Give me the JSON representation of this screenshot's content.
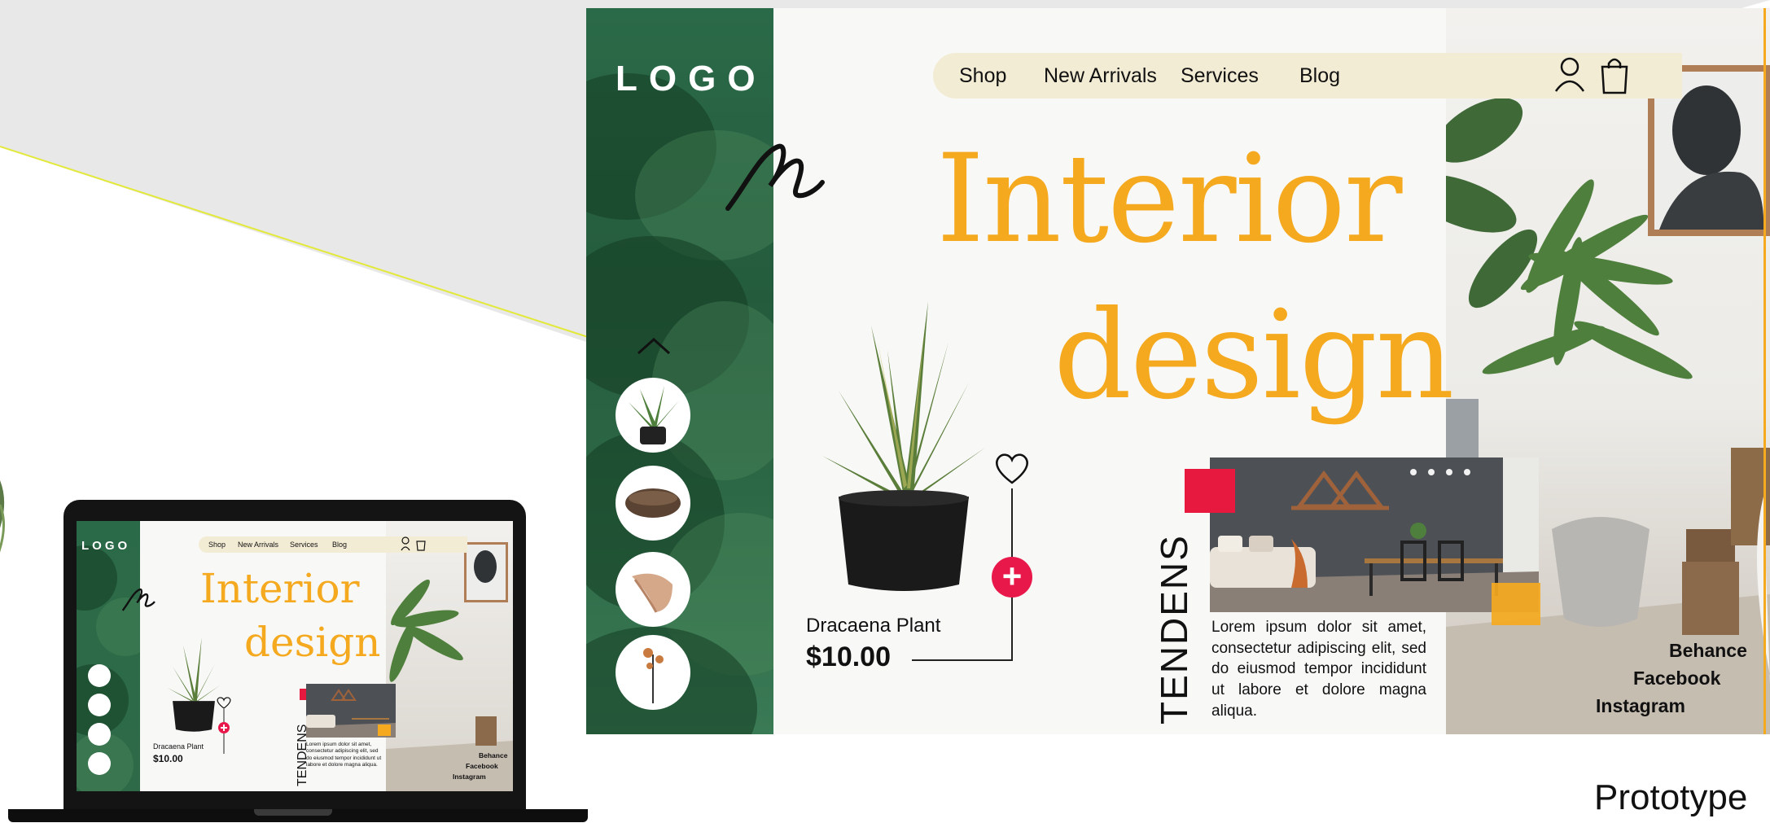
{
  "main": {
    "logo": "LOGO",
    "nav": [
      "Shop",
      "New Arrivals",
      "Services",
      "Blog"
    ],
    "hero_title_line1": "Interior",
    "hero_title_line2": "design",
    "product": {
      "name": "Dracaena Plant",
      "price": "$10.00"
    },
    "section_label": "TENDENS",
    "section_text": "Lorem ipsum dolor sit amet, consectetur adipiscing elit, sed do eiusmod tempor incididunt ut labore et dolore magna aliqua.",
    "social": [
      "Behance",
      "Facebook",
      "Instagram"
    ]
  },
  "laptop": {
    "logo": "LOGO",
    "nav": [
      "Shop",
      "New Arrivals",
      "Services",
      "Blog"
    ],
    "hero_title_line1": "Interior",
    "hero_title_line2": "design",
    "product": {
      "name": "Dracaena Plant",
      "price": "$10.00"
    },
    "section_label": "TENDENS",
    "section_text": "Lorem ipsum dolor sit amet, consectetur adipiscing elit, sed do eiusmod tempor incididunt ut labore et dolore magna aliqua.",
    "social": [
      "Behance",
      "Facebook",
      "Instagram"
    ]
  },
  "caption": "Prototype",
  "colors": {
    "accent_orange": "#f5a91f",
    "brand_green": "#2b6a48",
    "accent_red": "#e8193f",
    "nav_cream": "#f3ecd4"
  },
  "icons": [
    "user-icon",
    "shopping-bag-icon",
    "heart-icon",
    "plus-icon",
    "chevron-up-icon"
  ]
}
